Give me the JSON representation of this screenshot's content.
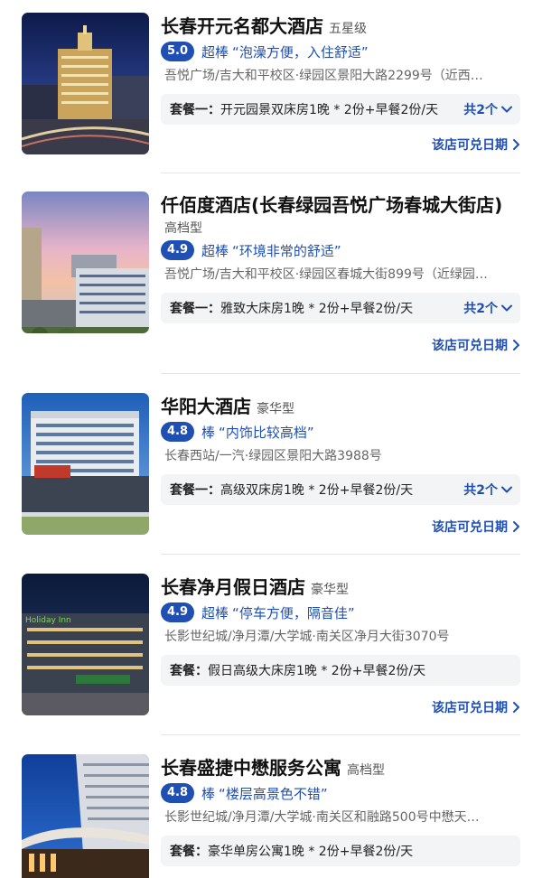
{
  "hotels": [
    {
      "name": "长春开元名都大酒店",
      "grade": "五星级",
      "score": "5.0",
      "rating_word": "超棒",
      "quote": "“泡澡方便，入住舒适”",
      "address": "吾悦广场/吉大和平校区·绿园区景阳大路2299号（近西…",
      "package_label": "套餐一：",
      "package_desc": "开元园景双床房1晚 * 2份+早餐2份/天",
      "package_count": "共2个",
      "redeem_link": "该店可兑日期"
    },
    {
      "name": "仟佰度酒店(长春绿园吾悦广场春城大街店)",
      "grade": "高档型",
      "score": "4.9",
      "rating_word": "超棒",
      "quote": "“环境非常的舒适”",
      "address": "吾悦广场/吉大和平校区·绿园区春城大街899号（近绿园…",
      "package_label": "套餐一：",
      "package_desc": "雅致大床房1晚 * 2份+早餐2份/天",
      "package_count": "共2个",
      "redeem_link": "该店可兑日期"
    },
    {
      "name": "华阳大酒店",
      "grade": "豪华型",
      "score": "4.8",
      "rating_word": "棒",
      "quote": "“内饰比较高档”",
      "address": "长春西站/一汽·绿园区景阳大路3988号",
      "package_label": "套餐一：",
      "package_desc": "高级双床房1晚 * 2份+早餐2份/天",
      "package_count": "共2个",
      "redeem_link": "该店可兑日期"
    },
    {
      "name": "长春净月假日酒店",
      "grade": "豪华型",
      "score": "4.9",
      "rating_word": "超棒",
      "quote": "“停车方便，隔音佳”",
      "address": "长影世纪城/净月潭/大学城·南关区净月大街3070号",
      "package_label": "套餐：",
      "package_desc": "假日高级大床房1晚 * 2份+早餐2份/天",
      "package_count": "",
      "redeem_link": "该店可兑日期",
      "photo_sign": "Holiday Inn"
    },
    {
      "name": "长春盛捷中懋服务公寓",
      "grade": "高档型",
      "score": "4.8",
      "rating_word": "棒",
      "quote": "“楼层高景色不错”",
      "address": "长影世纪城/净月潭/大学城·南关区和融路500号中懋天…",
      "package_label": "套餐：",
      "package_desc": "豪华单房公寓1晚 * 2份+早餐2份/天",
      "package_count": "",
      "redeem_link": ""
    }
  ],
  "colors": {
    "accent": "#1f4fb3",
    "package_bg": "#f3f4f6",
    "divider": "#e5e5e5"
  },
  "icons": {
    "expand": "chevron-down-icon",
    "link": "chevron-right-icon"
  }
}
